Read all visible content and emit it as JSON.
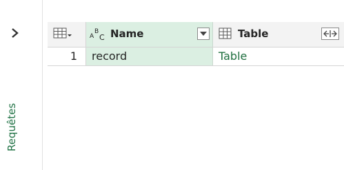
{
  "queries_pane": {
    "label": "Requêtes",
    "expand_icon": "chevron-right-icon"
  },
  "grid": {
    "columns": [
      {
        "type_icon": "abc-type-icon",
        "type_label": "ABC",
        "name": "Name",
        "menu_icon": "dropdown-arrow-icon"
      },
      {
        "type_icon": "table-type-icon",
        "name": "Table",
        "menu_icon": "expand-columns-icon"
      }
    ],
    "rows": [
      {
        "index": "1",
        "name": "record",
        "table": "Table"
      }
    ]
  },
  "colors": {
    "selected_column": "#dbefe2",
    "accent": "#217346",
    "header_bg": "#f3f3f3"
  }
}
